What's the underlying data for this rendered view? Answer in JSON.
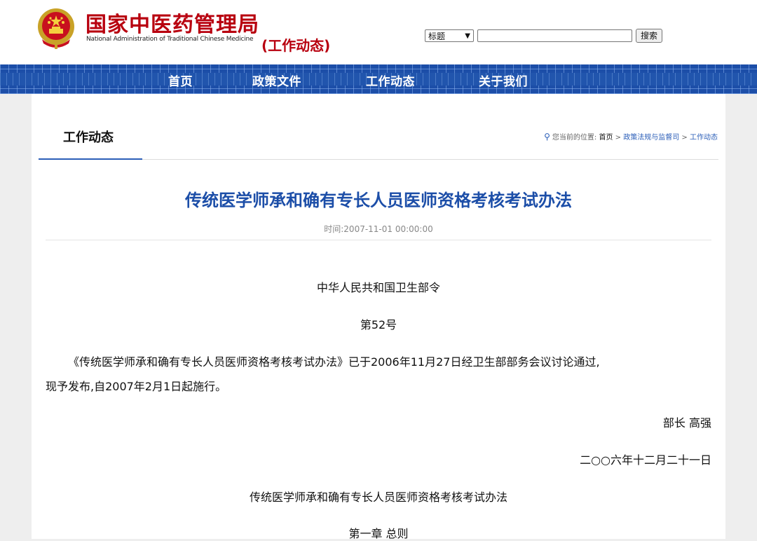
{
  "header": {
    "logo_cn": "国家中医药管理局",
    "logo_en": "National Administration of Traditional Chinese Medicine",
    "section_tag": "(工作动态)",
    "emblem_icon": "national-emblem-icon"
  },
  "search": {
    "select_value": "标题",
    "input_value": "",
    "button_label": "搜索"
  },
  "nav": {
    "items": [
      {
        "label": "首页"
      },
      {
        "label": "政策文件"
      },
      {
        "label": "工作动态"
      },
      {
        "label": "关于我们"
      }
    ]
  },
  "column": {
    "title": "工作动态"
  },
  "breadcrumb": {
    "prefix": "您当前的位置:",
    "home": "首页",
    "sep1": ">",
    "level1": "政策法规与监督司",
    "sep2": ">",
    "level2": "工作动态"
  },
  "article": {
    "title": "传统医学师承和确有专长人员医师资格考核考试办法",
    "time": "时间:2007-11-01 00:00:00",
    "issuer": "中华人民共和国卫生部令",
    "number": "第52号",
    "body_line1": "《传统医学师承和确有专长人员医师资格考核考试办法》已于2006年11月27日经卫生部部务会议讨论通过,",
    "body_line2": "现予发布,自2007年2月1日起施行。",
    "signature": "部长 高强",
    "date": "二○○六年十二月二十一日",
    "doc_title": "传统医学师承和确有专长人员医师资格考核考试办法",
    "chapter": "第一章 总则"
  },
  "colors": {
    "brand_red": "#b8000f",
    "nav_blue": "#1c4ea8",
    "title_blue": "#1c4ea8"
  }
}
